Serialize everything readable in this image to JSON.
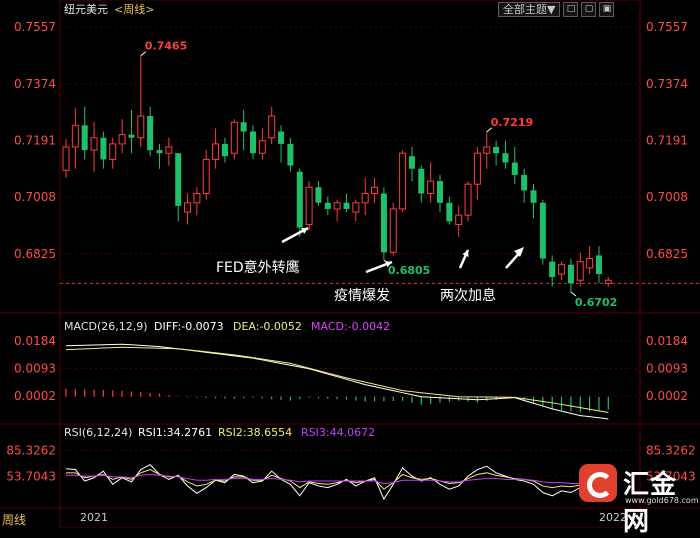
{
  "header": {
    "symbol": "纽元美元",
    "period": "<周线>",
    "theme_select": "全部主题▼",
    "buttons": [
      "□",
      "▢",
      "▣"
    ]
  },
  "footer": {
    "period_label": "周线",
    "watermark_cn": "汇金网",
    "watermark_url": "www.gold678.com"
  },
  "colors": {
    "up": "#ff3c3c",
    "down": "#20c06a",
    "axis_label": "#ff4a4a",
    "grid": "#4a0000",
    "price_line": "#d23c3c",
    "diff": "#ffffff",
    "dea": "#f0ec78",
    "rsi1": "#ffffff",
    "rsi2": "#f0ec78",
    "rsi3": "#c040ff"
  },
  "chart_data": [
    {
      "type": "candlestick",
      "title": "纽元美元<周线>",
      "ylim": [
        0.666,
        0.758
      ],
      "y_ticks": [
        0.7557,
        0.7374,
        0.7191,
        0.7008,
        0.6825
      ],
      "x_labels": [
        "2021",
        "2022"
      ],
      "reference_line": 0.673,
      "candles": [
        {
          "o": 0.7095,
          "h": 0.7195,
          "l": 0.707,
          "c": 0.717
        },
        {
          "o": 0.717,
          "h": 0.7295,
          "l": 0.71,
          "c": 0.724
        },
        {
          "o": 0.724,
          "h": 0.73,
          "l": 0.713,
          "c": 0.716
        },
        {
          "o": 0.716,
          "h": 0.725,
          "l": 0.709,
          "c": 0.72
        },
        {
          "o": 0.72,
          "h": 0.722,
          "l": 0.71,
          "c": 0.713
        },
        {
          "o": 0.713,
          "h": 0.72,
          "l": 0.71,
          "c": 0.718
        },
        {
          "o": 0.718,
          "h": 0.726,
          "l": 0.715,
          "c": 0.721
        },
        {
          "o": 0.721,
          "h": 0.729,
          "l": 0.715,
          "c": 0.72
        },
        {
          "o": 0.72,
          "h": 0.7465,
          "l": 0.717,
          "c": 0.727
        },
        {
          "o": 0.727,
          "h": 0.73,
          "l": 0.714,
          "c": 0.716
        },
        {
          "o": 0.716,
          "h": 0.718,
          "l": 0.71,
          "c": 0.715
        },
        {
          "o": 0.715,
          "h": 0.72,
          "l": 0.711,
          "c": 0.717
        },
        {
          "o": 0.715,
          "h": 0.715,
          "l": 0.693,
          "c": 0.698
        },
        {
          "o": 0.696,
          "h": 0.702,
          "l": 0.692,
          "c": 0.699
        },
        {
          "o": 0.699,
          "h": 0.704,
          "l": 0.695,
          "c": 0.702
        },
        {
          "o": 0.702,
          "h": 0.716,
          "l": 0.7,
          "c": 0.713
        },
        {
          "o": 0.713,
          "h": 0.723,
          "l": 0.71,
          "c": 0.718
        },
        {
          "o": 0.718,
          "h": 0.72,
          "l": 0.712,
          "c": 0.714
        },
        {
          "o": 0.715,
          "h": 0.726,
          "l": 0.713,
          "c": 0.725
        },
        {
          "o": 0.725,
          "h": 0.729,
          "l": 0.716,
          "c": 0.722
        },
        {
          "o": 0.722,
          "h": 0.724,
          "l": 0.713,
          "c": 0.715
        },
        {
          "o": 0.715,
          "h": 0.723,
          "l": 0.713,
          "c": 0.719
        },
        {
          "o": 0.72,
          "h": 0.73,
          "l": 0.718,
          "c": 0.727
        },
        {
          "o": 0.722,
          "h": 0.724,
          "l": 0.712,
          "c": 0.718
        },
        {
          "o": 0.718,
          "h": 0.72,
          "l": 0.709,
          "c": 0.711
        },
        {
          "o": 0.709,
          "h": 0.71,
          "l": 0.688,
          "c": 0.691
        },
        {
          "o": 0.692,
          "h": 0.706,
          "l": 0.69,
          "c": 0.704
        },
        {
          "o": 0.704,
          "h": 0.706,
          "l": 0.698,
          "c": 0.699
        },
        {
          "o": 0.699,
          "h": 0.701,
          "l": 0.695,
          "c": 0.697
        },
        {
          "o": 0.697,
          "h": 0.7,
          "l": 0.693,
          "c": 0.699
        },
        {
          "o": 0.699,
          "h": 0.702,
          "l": 0.696,
          "c": 0.697
        },
        {
          "o": 0.696,
          "h": 0.7,
          "l": 0.693,
          "c": 0.699
        },
        {
          "o": 0.699,
          "h": 0.707,
          "l": 0.695,
          "c": 0.702
        },
        {
          "o": 0.702,
          "h": 0.707,
          "l": 0.699,
          "c": 0.704
        },
        {
          "o": 0.702,
          "h": 0.704,
          "l": 0.6805,
          "c": 0.683
        },
        {
          "o": 0.683,
          "h": 0.699,
          "l": 0.682,
          "c": 0.697
        },
        {
          "o": 0.697,
          "h": 0.716,
          "l": 0.696,
          "c": 0.715
        },
        {
          "o": 0.714,
          "h": 0.717,
          "l": 0.706,
          "c": 0.71
        },
        {
          "o": 0.71,
          "h": 0.711,
          "l": 0.699,
          "c": 0.702
        },
        {
          "o": 0.702,
          "h": 0.712,
          "l": 0.699,
          "c": 0.706
        },
        {
          "o": 0.706,
          "h": 0.708,
          "l": 0.696,
          "c": 0.699
        },
        {
          "o": 0.699,
          "h": 0.701,
          "l": 0.692,
          "c": 0.693
        },
        {
          "o": 0.692,
          "h": 0.698,
          "l": 0.688,
          "c": 0.695
        },
        {
          "o": 0.695,
          "h": 0.706,
          "l": 0.693,
          "c": 0.705
        },
        {
          "o": 0.705,
          "h": 0.717,
          "l": 0.7,
          "c": 0.715
        },
        {
          "o": 0.715,
          "h": 0.7219,
          "l": 0.71,
          "c": 0.717
        },
        {
          "o": 0.717,
          "h": 0.719,
          "l": 0.711,
          "c": 0.715
        },
        {
          "o": 0.715,
          "h": 0.719,
          "l": 0.71,
          "c": 0.712
        },
        {
          "o": 0.712,
          "h": 0.717,
          "l": 0.705,
          "c": 0.708
        },
        {
          "o": 0.708,
          "h": 0.71,
          "l": 0.699,
          "c": 0.703
        },
        {
          "o": 0.703,
          "h": 0.705,
          "l": 0.694,
          "c": 0.699
        },
        {
          "o": 0.699,
          "h": 0.7,
          "l": 0.679,
          "c": 0.681
        },
        {
          "o": 0.68,
          "h": 0.682,
          "l": 0.672,
          "c": 0.675
        },
        {
          "o": 0.676,
          "h": 0.68,
          "l": 0.674,
          "c": 0.679
        },
        {
          "o": 0.679,
          "h": 0.681,
          "l": 0.6702,
          "c": 0.673
        },
        {
          "o": 0.674,
          "h": 0.683,
          "l": 0.672,
          "c": 0.68
        },
        {
          "o": 0.678,
          "h": 0.685,
          "l": 0.676,
          "c": 0.681
        },
        {
          "o": 0.682,
          "h": 0.685,
          "l": 0.673,
          "c": 0.676
        },
        {
          "o": 0.673,
          "h": 0.675,
          "l": 0.672,
          "c": 0.674
        }
      ],
      "price_labels": [
        {
          "text": "0.7465",
          "index": 8,
          "value": 0.7465,
          "kind": "high"
        },
        {
          "text": "0.7219",
          "index": 45,
          "value": 0.7219,
          "kind": "high"
        },
        {
          "text": "0.6805",
          "index": 34,
          "value": 0.6805,
          "kind": "low"
        },
        {
          "text": "0.6702",
          "index": 54,
          "value": 0.6702,
          "kind": "low"
        }
      ],
      "annotations": [
        {
          "text": "FED意外转鹰",
          "index": 27
        },
        {
          "text": "疫情爆发",
          "index": 34
        },
        {
          "text": "两次加息",
          "index": 43
        }
      ]
    },
    {
      "type": "line",
      "title": "MACD(26,12,9)",
      "indicator_text": {
        "diff": "DIFF:-0.0073",
        "dea": "DEA:-0.0052",
        "macd": "MACD:-0.0042"
      },
      "ylim": [
        -0.007,
        0.02
      ],
      "y_ticks": [
        0.0184,
        0.0093,
        0.0002
      ],
      "diff_anchors": [
        [
          0,
          0.0168
        ],
        [
          6,
          0.0173
        ],
        [
          10,
          0.0165
        ],
        [
          14,
          0.015
        ],
        [
          20,
          0.0127
        ],
        [
          26,
          0.0092
        ],
        [
          32,
          0.004
        ],
        [
          38,
          0.0
        ],
        [
          44,
          -0.001
        ],
        [
          48,
          -0.0003
        ],
        [
          52,
          -0.004
        ],
        [
          55,
          -0.0062
        ],
        [
          58,
          -0.0073
        ]
      ],
      "dea_anchors": [
        [
          0,
          0.0155
        ],
        [
          6,
          0.0163
        ],
        [
          12,
          0.0158
        ],
        [
          18,
          0.0138
        ],
        [
          24,
          0.011
        ],
        [
          30,
          0.0062
        ],
        [
          36,
          0.002
        ],
        [
          42,
          0.0
        ],
        [
          48,
          -0.0002
        ],
        [
          52,
          -0.002
        ],
        [
          58,
          -0.0052
        ]
      ],
      "hist_scale": 1.0
    },
    {
      "type": "line",
      "title": "RSI(6,12,24)",
      "indicator_text": {
        "rsi1": "RSI1:34.2761",
        "rsi2": "RSI2:38.6554",
        "rsi3": "RSI3:44.0672"
      },
      "ylim": [
        20,
        98
      ],
      "y_ticks": [
        85.3262,
        53.7043
      ],
      "rsi1": [
        63,
        62,
        48,
        52,
        60,
        44,
        52,
        47,
        62,
        68,
        56,
        50,
        55,
        42,
        33,
        40,
        49,
        46,
        56,
        54,
        46,
        48,
        60,
        50,
        44,
        30,
        46,
        42,
        40,
        44,
        50,
        42,
        48,
        52,
        26,
        44,
        64,
        54,
        48,
        52,
        44,
        38,
        42,
        54,
        62,
        66,
        58,
        54,
        50,
        48,
        44,
        34,
        30,
        36,
        34,
        40,
        42,
        36,
        34
      ],
      "rsi2": [
        58,
        58,
        52,
        54,
        56,
        50,
        53,
        50,
        58,
        62,
        56,
        53,
        54,
        47,
        42,
        44,
        49,
        48,
        53,
        53,
        49,
        49,
        55,
        51,
        48,
        40,
        47,
        45,
        44,
        46,
        49,
        46,
        48,
        50,
        38,
        46,
        56,
        52,
        50,
        51,
        48,
        45,
        46,
        51,
        56,
        58,
        55,
        53,
        51,
        50,
        48,
        42,
        40,
        42,
        41,
        43,
        44,
        41,
        39
      ],
      "rsi3": [
        55,
        55,
        54,
        54,
        55,
        53,
        53,
        52,
        55,
        56,
        55,
        54,
        53,
        51,
        49,
        49,
        50,
        50,
        51,
        51,
        50,
        50,
        51,
        50,
        49,
        47,
        48,
        48,
        48,
        48,
        48,
        48,
        48,
        48,
        45,
        46,
        49,
        49,
        49,
        49,
        48,
        47,
        47,
        49,
        50,
        51,
        51,
        50,
        50,
        50,
        49,
        47,
        46,
        46,
        45,
        45,
        45,
        45,
        44
      ]
    }
  ]
}
